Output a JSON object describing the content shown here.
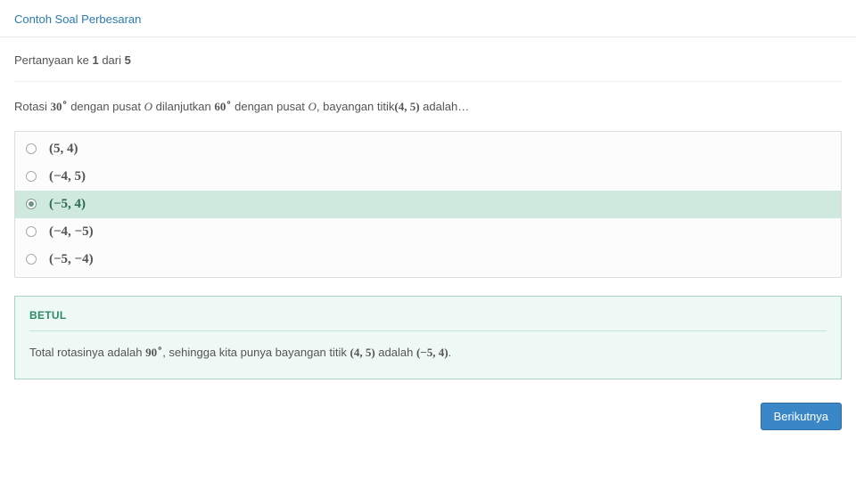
{
  "header": {
    "link_text": "Contoh Soal Perbesaran"
  },
  "question": {
    "prefix": "Pertanyaan ke",
    "current": "1",
    "of_word": "dari",
    "total": "5",
    "text_parts": {
      "p1": "Rotasi ",
      "deg1": "30",
      "p2": " dengan pusat ",
      "center1": "O",
      "p3": " dilanjutkan ",
      "deg2": "60",
      "p4": " dengan pusat ",
      "center2": "O",
      "p5": ", bayangan titik",
      "point": "(4, 5)",
      "p6": " adalah…"
    }
  },
  "options": [
    {
      "label": "(5, 4)",
      "selected": false
    },
    {
      "label": "(−4, 5)",
      "selected": false
    },
    {
      "label": "(−5, 4)",
      "selected": true
    },
    {
      "label": "(−4, −5)",
      "selected": false
    },
    {
      "label": "(−5, −4)",
      "selected": false
    }
  ],
  "feedback": {
    "title": "BETUL",
    "body_parts": {
      "p1": "Total rotasinya adalah ",
      "deg": "90",
      "p2": ", sehingga kita punya bayangan titik ",
      "pt1": "(4, 5)",
      "p3": " adalah ",
      "pt2": "(−5, 4)",
      "p4": "."
    }
  },
  "buttons": {
    "next": "Berikutnya"
  }
}
